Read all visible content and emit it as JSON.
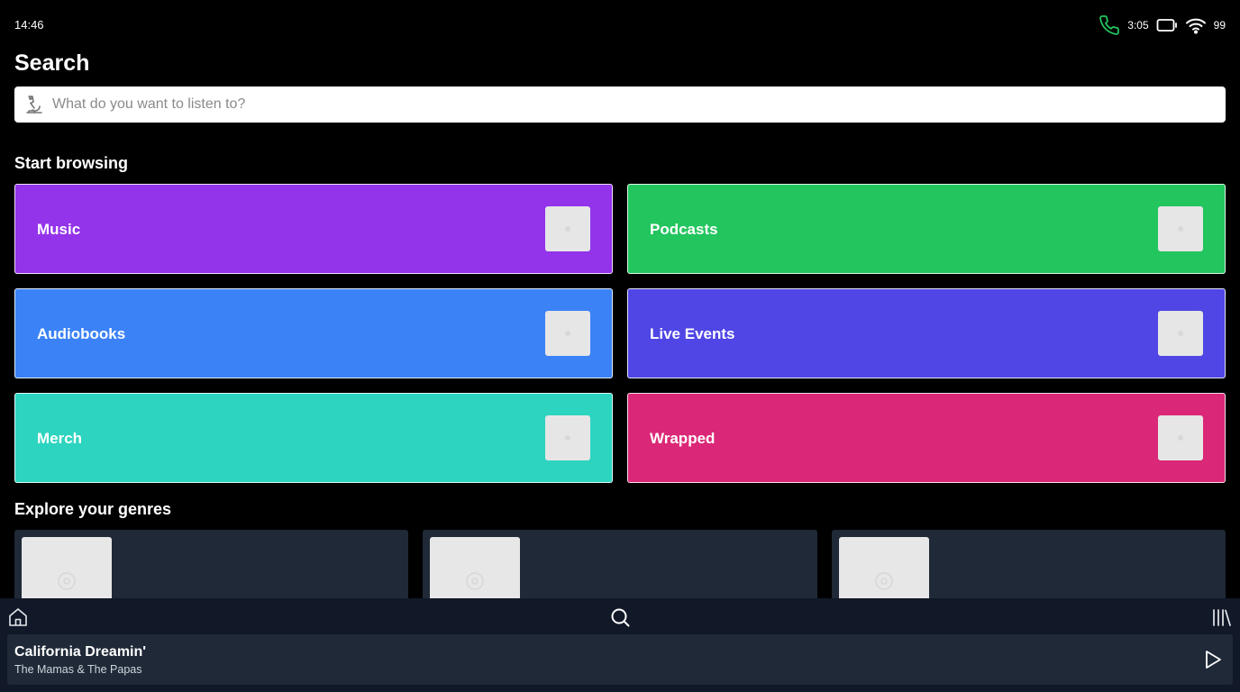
{
  "status_bar": {
    "time": "14:46",
    "call_duration": "3:05",
    "battery_level": "99",
    "icons": [
      "phone-icon",
      "battery-icon",
      "wifi-icon"
    ],
    "call_icon_color": "#22c55e"
  },
  "header": {
    "title": "Search"
  },
  "search": {
    "placeholder": "What do you want to listen to?",
    "value": "",
    "leading_icon": "microphone-icon"
  },
  "browse": {
    "heading": "Start browsing",
    "categories": [
      {
        "label": "Music",
        "color": "#9333ea"
      },
      {
        "label": "Podcasts",
        "color": "#22c55e"
      },
      {
        "label": "Audiobooks",
        "color": "#3b82f6"
      },
      {
        "label": "Live Events",
        "color": "#4f46e5"
      },
      {
        "label": "Merch",
        "color": "#2dd4bf"
      },
      {
        "label": "Wrapped",
        "color": "#db2777"
      }
    ]
  },
  "genres": {
    "heading": "Explore your genres",
    "card_count": 3,
    "card_color": "#1f2937"
  },
  "bottom_nav": {
    "items": [
      "home-icon",
      "search-icon",
      "library-icon"
    ],
    "background": "#111827"
  },
  "now_playing": {
    "title": "California Dreamin'",
    "artist": "The Mamas & The Papas",
    "control_icon": "play-icon"
  }
}
